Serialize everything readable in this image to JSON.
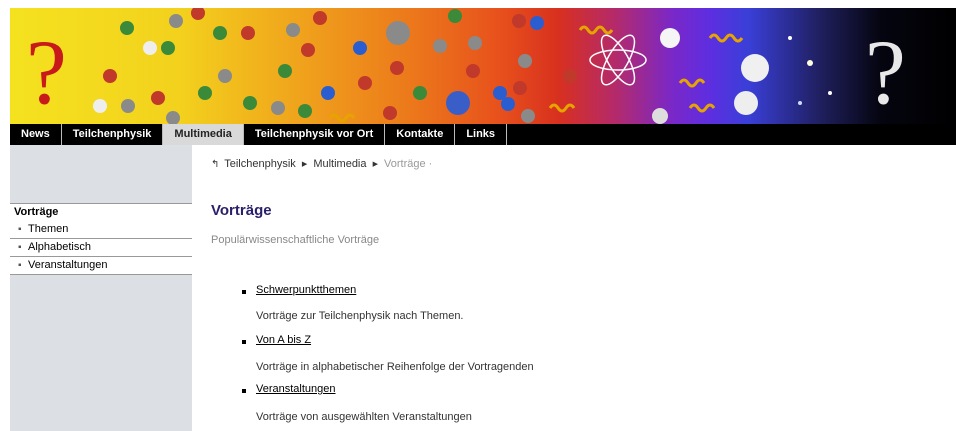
{
  "banner": {
    "question_mark": "?"
  },
  "nav": {
    "items": [
      "News",
      "Teilchenphysik",
      "Multimedia",
      "Teilchenphysik vor Ort",
      "Kontakte",
      "Links"
    ],
    "active": "Multimedia"
  },
  "breadcrumb": {
    "items": [
      "Teilchenphysik",
      "Multimedia",
      "Vorträge"
    ],
    "up_icon": "up-arrow-icon"
  },
  "sidebar": {
    "title": "Vorträge",
    "items": [
      "Themen",
      "Alphabetisch",
      "Veranstaltungen"
    ]
  },
  "main": {
    "title": "Vorträge",
    "subtitle": "Populärwissenschaftliche Vorträge",
    "entries": [
      {
        "link": "Schwerpunktthemen",
        "desc": "Vorträge zur Teilchenphysik nach Themen."
      },
      {
        "link": "Von A bis Z",
        "desc": "Vorträge in alphabetischer Reihenfolge der Vortragenden"
      },
      {
        "link": "Veranstaltungen",
        "desc": "Vorträge von ausgewählten Veranstaltungen"
      }
    ]
  },
  "colors": {
    "title": "#2a1f6b",
    "sidebar_bg": "#dcdfe4",
    "nav_bg": "#000000"
  }
}
